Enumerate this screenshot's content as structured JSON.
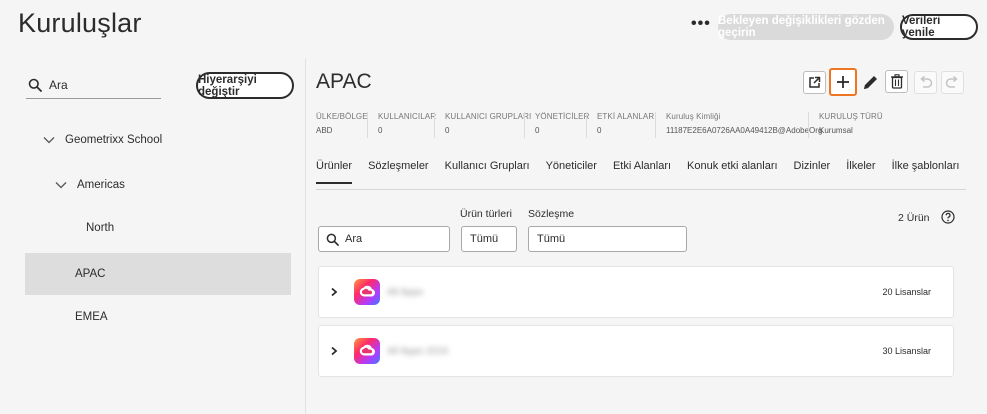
{
  "header": {
    "title": "Kuruluşlar",
    "more_label": "•••",
    "review_button": "Bekleyen değişiklikleri gözden geçirin",
    "refresh_button": "Verileri yenile"
  },
  "sidebar": {
    "search_placeholder": "Ara",
    "hierarchy_button": "Hiyerarşiyi değiştir",
    "tree": [
      {
        "label": "Geometrixx School",
        "expanded": true
      },
      {
        "label": "Americas",
        "expanded": true
      },
      {
        "label": "North"
      },
      {
        "label": "APAC",
        "selected": true
      },
      {
        "label": "EMEA"
      }
    ]
  },
  "org": {
    "name": "APAC",
    "info": [
      {
        "label": "ÜLKE/BÖLGE",
        "value": "ABD"
      },
      {
        "label": "KULLANICILAR",
        "value": "0"
      },
      {
        "label": "KULLANICI GRUPLARI",
        "value": "0"
      },
      {
        "label": "YÖNETİCİLER",
        "value": "0"
      },
      {
        "label": "ETKİ ALANLARI",
        "value": "0"
      },
      {
        "label": "Kuruluş Kimliği",
        "value": "11187E2E6A0726AA0A49412B@AdobeOrg"
      },
      {
        "label": "KURULUŞ TÜRÜ",
        "value": "Kurumsal"
      }
    ]
  },
  "tabs": [
    {
      "label": "Ürünler",
      "active": true
    },
    {
      "label": "Sözleşmeler"
    },
    {
      "label": "Kullanıcı Grupları"
    },
    {
      "label": "Yöneticiler"
    },
    {
      "label": "Etki Alanları"
    },
    {
      "label": "Konuk etki alanları"
    },
    {
      "label": "Dizinler"
    },
    {
      "label": "İlkeler"
    },
    {
      "label": "İlke şablonları"
    }
  ],
  "filters": {
    "search_placeholder": "Ara",
    "types_label": "Ürün türleri",
    "types_value": "Tümü",
    "contract_label": "Sözleşme",
    "contract_value": "Tümü",
    "count": "2 Ürün"
  },
  "products": [
    {
      "name": "All Apps",
      "licenses": "20 Lisanslar"
    },
    {
      "name": "All Apps 2016",
      "licenses": "30 Lisanslar"
    }
  ],
  "colors": {
    "highlight": "#ee7623",
    "selected_row": "#dddddd",
    "disabled_button": "#dadada"
  },
  "icons": [
    "search-icon",
    "chevron-down-icon",
    "open-external-icon",
    "add-icon",
    "edit-icon",
    "delete-icon",
    "undo-icon",
    "redo-icon",
    "help-icon",
    "chevron-right-icon",
    "creative-cloud-icon"
  ]
}
